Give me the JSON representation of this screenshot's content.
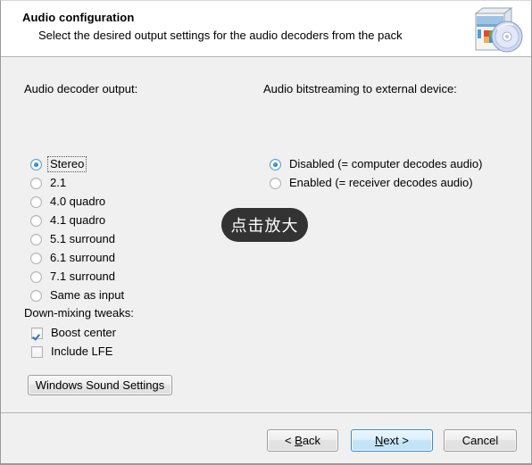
{
  "header": {
    "title": "Audio configuration",
    "subtitle": "Select the desired output settings for the audio decoders from the pack",
    "icon": "software-box-disc-icon"
  },
  "left_panel": {
    "group_label": "Audio decoder output:",
    "options": [
      {
        "label": "Stereo",
        "selected": true,
        "focused": true
      },
      {
        "label": "2.1",
        "selected": false,
        "focused": false
      },
      {
        "label": "4.0 quadro",
        "selected": false,
        "focused": false
      },
      {
        "label": "4.1 quadro",
        "selected": false,
        "focused": false
      },
      {
        "label": "5.1 surround",
        "selected": false,
        "focused": false
      },
      {
        "label": "6.1 surround",
        "selected": false,
        "focused": false
      },
      {
        "label": "7.1 surround",
        "selected": false,
        "focused": false
      },
      {
        "label": "Same as input",
        "selected": false,
        "focused": false
      }
    ],
    "downmix_label": "Down-mixing tweaks:",
    "checkboxes": [
      {
        "label": "Boost center",
        "checked": true
      },
      {
        "label": "Include LFE",
        "checked": false
      }
    ],
    "sound_settings_button": "Windows Sound Settings"
  },
  "right_panel": {
    "group_label": "Audio bitstreaming to external device:",
    "options": [
      {
        "label": "Disabled  (= computer decodes audio)",
        "selected": true
      },
      {
        "label": "Enabled  (= receiver decodes audio)",
        "selected": false
      }
    ]
  },
  "footer": {
    "back_button": "< Back",
    "back_mnemonic": "B",
    "next_button": "Next >",
    "next_mnemonic": "N",
    "cancel_button": "Cancel"
  },
  "overlay": {
    "zoom_hint": "点击放大"
  },
  "colors": {
    "body_background": "#f0f0f0",
    "header_background": "#ffffff",
    "accent_blue": "#1f7fc4",
    "default_button_border": "#3c8cc0",
    "overlay_background": "#333333"
  }
}
